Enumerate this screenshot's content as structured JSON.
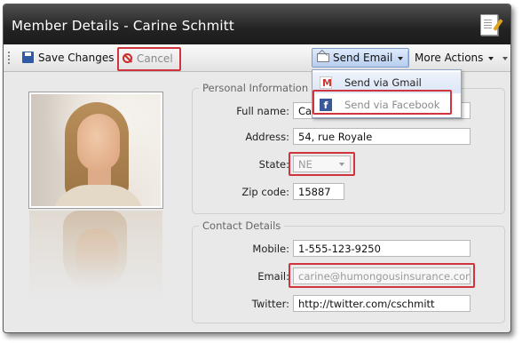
{
  "window": {
    "title": "Member Details - Carine Schmitt"
  },
  "toolbar": {
    "save_label": "Save Changes",
    "cancel_label": "Cancel",
    "send_email_label": "Send Email",
    "more_actions_label": "More Actions"
  },
  "send_menu": {
    "items": [
      {
        "label": "Send via Gmail",
        "icon": "gmail-icon"
      },
      {
        "label": "Send via Facebook",
        "icon": "facebook-icon"
      }
    ]
  },
  "personal": {
    "legend": "Personal Information",
    "fullname_label": "Full name:",
    "fullname_value": "Car",
    "address_label": "Address:",
    "address_value": "54, rue Royale",
    "state_label": "State:",
    "state_value": "NE",
    "zip_label": "Zip code:",
    "zip_value": "15887"
  },
  "contact": {
    "legend": "Contact Details",
    "mobile_label": "Mobile:",
    "mobile_value": "1-555-123-9250",
    "email_label": "Email:",
    "email_value": "carine@humongousinsurance.com",
    "twitter_label": "Twitter:",
    "twitter_value": "http://twitter.com/cschmitt"
  },
  "colors": {
    "titlebar": "#232323",
    "highlight_red": "#d0343d",
    "menu_hover": "#dbe6f7"
  }
}
